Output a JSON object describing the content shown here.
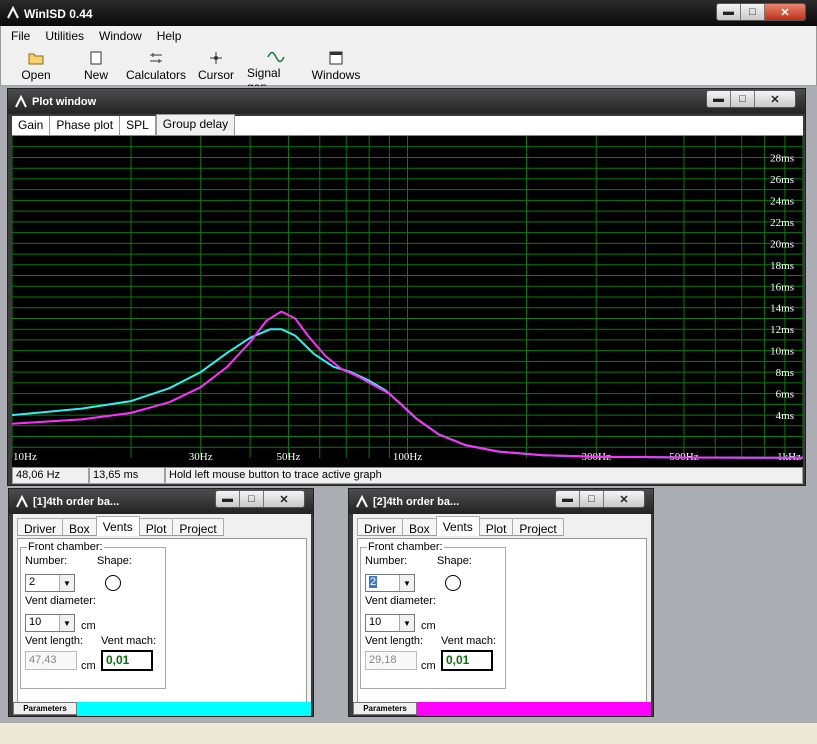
{
  "app": {
    "title": "WinISD 0.44",
    "menu": [
      "File",
      "Utilities",
      "Window",
      "Help"
    ],
    "toolbar": [
      {
        "label": "Open",
        "icon": "folder-open-icon"
      },
      {
        "label": "New",
        "icon": "new-document-icon"
      },
      {
        "label": "Calculators",
        "icon": "calculator-icon"
      },
      {
        "label": "Cursor",
        "icon": "crosshair-cursor-icon"
      },
      {
        "label": "Signal gen.",
        "icon": "signal-generator-icon"
      },
      {
        "label": "Windows",
        "icon": "windows-icon"
      }
    ]
  },
  "plot_window": {
    "title": "Plot window",
    "tabs": [
      "Gain",
      "Phase plot",
      "SPL",
      "Group delay"
    ],
    "active_tab": "Group delay",
    "status": {
      "frequency": "48,06 Hz",
      "value": "13,65 ms",
      "hint": "Hold left mouse button to trace active graph"
    }
  },
  "chart_data": {
    "type": "line",
    "xscale": "log",
    "xlim": [
      10,
      1000
    ],
    "ylim": [
      0,
      30
    ],
    "grid": true,
    "x_ticks": [
      {
        "v": 10,
        "label": "10Hz"
      },
      {
        "v": 30,
        "label": "30Hz"
      },
      {
        "v": 50,
        "label": "50Hz"
      },
      {
        "v": 100,
        "label": "100Hz"
      },
      {
        "v": 300,
        "label": "300Hz"
      },
      {
        "v": 500,
        "label": "500Hz"
      },
      {
        "v": 1000,
        "label": "1kHz"
      }
    ],
    "y_ticks": [
      {
        "v": 4,
        "label": "4ms"
      },
      {
        "v": 6,
        "label": "6ms"
      },
      {
        "v": 8,
        "label": "8ms"
      },
      {
        "v": 10,
        "label": "10ms"
      },
      {
        "v": 12,
        "label": "12ms"
      },
      {
        "v": 14,
        "label": "14ms"
      },
      {
        "v": 16,
        "label": "16ms"
      },
      {
        "v": 18,
        "label": "18ms"
      },
      {
        "v": 20,
        "label": "20ms"
      },
      {
        "v": 22,
        "label": "22ms"
      },
      {
        "v": 24,
        "label": "24ms"
      },
      {
        "v": 26,
        "label": "26ms"
      },
      {
        "v": 28,
        "label": "28ms"
      }
    ],
    "series": [
      {
        "color": "#30f0f0",
        "points": [
          [
            10,
            4.0
          ],
          [
            15,
            4.6
          ],
          [
            20,
            5.3
          ],
          [
            25,
            6.5
          ],
          [
            30,
            8.0
          ],
          [
            35,
            9.8
          ],
          [
            40,
            11.2
          ],
          [
            45,
            12.0
          ],
          [
            48,
            12.0
          ],
          [
            52,
            11.4
          ],
          [
            58,
            9.7
          ],
          [
            65,
            8.5
          ],
          [
            72,
            8.0
          ],
          [
            80,
            7.2
          ],
          [
            88,
            6.3
          ],
          [
            95,
            5.2
          ],
          [
            105,
            3.7
          ],
          [
            120,
            2.2
          ],
          [
            140,
            1.2
          ],
          [
            170,
            0.6
          ],
          [
            220,
            0.25
          ],
          [
            300,
            0.12
          ],
          [
            500,
            0.05
          ],
          [
            1000,
            0.02
          ]
        ]
      },
      {
        "color": "#ff30ff",
        "points": [
          [
            10,
            3.2
          ],
          [
            15,
            3.6
          ],
          [
            20,
            4.2
          ],
          [
            25,
            5.2
          ],
          [
            30,
            6.6
          ],
          [
            35,
            8.5
          ],
          [
            40,
            10.8
          ],
          [
            44,
            12.8
          ],
          [
            48,
            13.65
          ],
          [
            52,
            13.0
          ],
          [
            56,
            11.4
          ],
          [
            62,
            9.5
          ],
          [
            68,
            8.3
          ],
          [
            75,
            7.6
          ],
          [
            82,
            6.8
          ],
          [
            90,
            6.0
          ],
          [
            97,
            4.9
          ],
          [
            106,
            3.6
          ],
          [
            120,
            2.2
          ],
          [
            140,
            1.2
          ],
          [
            170,
            0.6
          ],
          [
            220,
            0.25
          ],
          [
            300,
            0.12
          ],
          [
            500,
            0.05
          ],
          [
            1000,
            0.02
          ]
        ]
      }
    ]
  },
  "child_windows": [
    {
      "title": "[1]4th order ba...",
      "tabs": [
        "Driver",
        "Box",
        "Vents",
        "Plot",
        "Project"
      ],
      "active_tab": "Vents",
      "group_label": "Front chamber:",
      "number_label": "Number:",
      "number_value": "2",
      "shape_label": "Shape:",
      "diameter_label": "Vent diameter:",
      "diameter_value": "10",
      "diameter_unit": "cm",
      "length_label": "Vent length:",
      "length_value": "47,43",
      "length_unit": "cm",
      "mach_label": "Vent mach:",
      "mach_value": "0,01",
      "params_label": "Parameters",
      "color": "#00ffff"
    },
    {
      "title": "[2]4th order ba...",
      "tabs": [
        "Driver",
        "Box",
        "Vents",
        "Plot",
        "Project"
      ],
      "active_tab": "Vents",
      "group_label": "Front chamber:",
      "number_label": "Number:",
      "number_value": "2",
      "shape_label": "Shape:",
      "diameter_label": "Vent diameter:",
      "diameter_value": "10",
      "diameter_unit": "cm",
      "length_label": "Vent length:",
      "length_value": "29,18",
      "length_unit": "cm",
      "mach_label": "Vent mach:",
      "mach_value": "0,01",
      "params_label": "Parameters",
      "color": "#ff00ff"
    }
  ]
}
